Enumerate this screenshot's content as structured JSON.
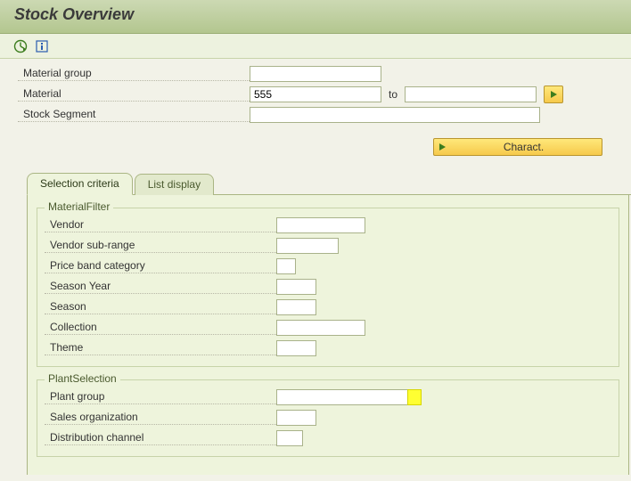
{
  "title": "Stock Overview",
  "toolbar": {
    "execute_icon": "execute",
    "info_icon": "info"
  },
  "header_fields": {
    "material_group": {
      "label": "Material group",
      "value": ""
    },
    "material": {
      "label": "Material",
      "value": "555",
      "to_label": "to",
      "to_value": ""
    },
    "stock_segment": {
      "label": "Stock Segment",
      "value": ""
    }
  },
  "charact_button": "Charact.",
  "tabs": {
    "selection": "Selection criteria",
    "list": "List display"
  },
  "material_filter": {
    "title": "MaterialFilter",
    "vendor": {
      "label": "Vendor",
      "value": ""
    },
    "vendor_sub_range": {
      "label": "Vendor sub-range",
      "value": ""
    },
    "price_band_category": {
      "label": "Price band category",
      "value": ""
    },
    "season_year": {
      "label": "Season Year",
      "value": ""
    },
    "season": {
      "label": "Season",
      "value": ""
    },
    "collection": {
      "label": "Collection",
      "value": ""
    },
    "theme": {
      "label": "Theme",
      "value": ""
    }
  },
  "plant_selection": {
    "title": "PlantSelection",
    "plant_group": {
      "label": "Plant group",
      "value": ""
    },
    "sales_org": {
      "label": "Sales organization",
      "value": ""
    },
    "dist_channel": {
      "label": "Distribution channel",
      "value": ""
    }
  }
}
